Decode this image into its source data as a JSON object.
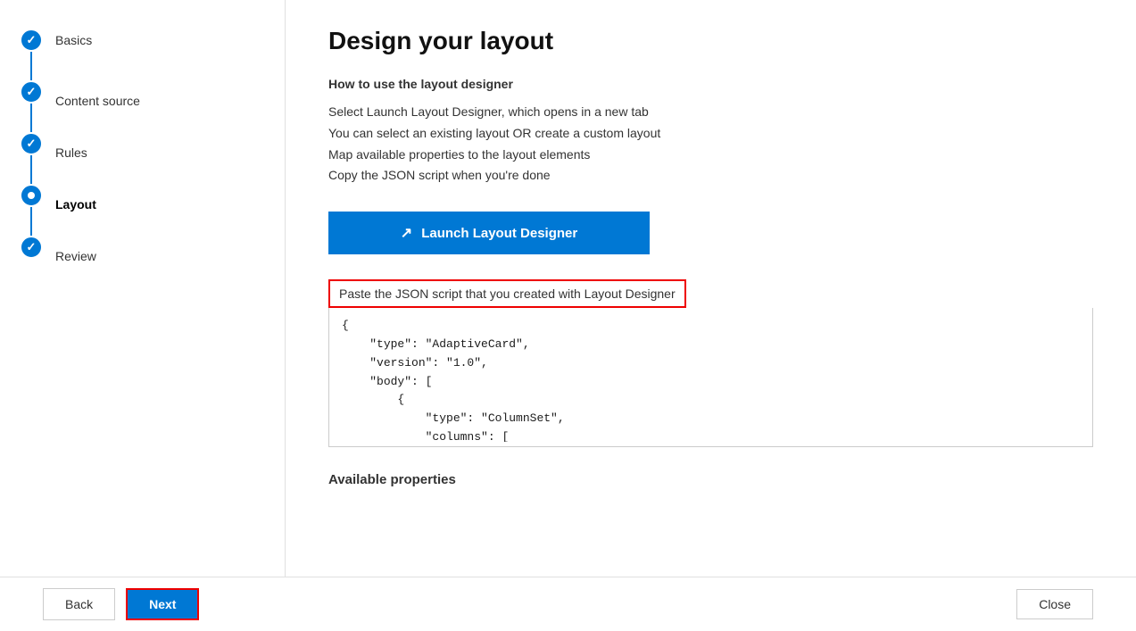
{
  "page": {
    "title": "Design your layout"
  },
  "sidebar": {
    "items": [
      {
        "id": "basics",
        "label": "Basics",
        "state": "completed"
      },
      {
        "id": "content-source",
        "label": "Content source",
        "state": "completed"
      },
      {
        "id": "rules",
        "label": "Rules",
        "state": "completed"
      },
      {
        "id": "layout",
        "label": "Layout",
        "state": "active"
      },
      {
        "id": "review",
        "label": "Review",
        "state": "completed"
      }
    ]
  },
  "content": {
    "page_title": "Design your layout",
    "how_to_heading": "How to use the layout designer",
    "instructions": [
      "Select Launch Layout Designer, which opens in a new tab",
      "You can select an existing layout OR create a custom layout",
      "Map available properties to the layout elements",
      "Copy the JSON script when you're done"
    ],
    "launch_button_label": "Launch Layout Designer",
    "json_label": "Paste the JSON script that you created with Layout Designer",
    "json_content": "{\n    \"type\": \"AdaptiveCard\",\n    \"version\": \"1.0\",\n    \"body\": [\n        {\n            \"type\": \"ColumnSet\",\n            \"columns\": [\n                {",
    "available_properties_label": "Available properties"
  },
  "footer": {
    "back_label": "Back",
    "next_label": "Next",
    "close_label": "Close"
  }
}
